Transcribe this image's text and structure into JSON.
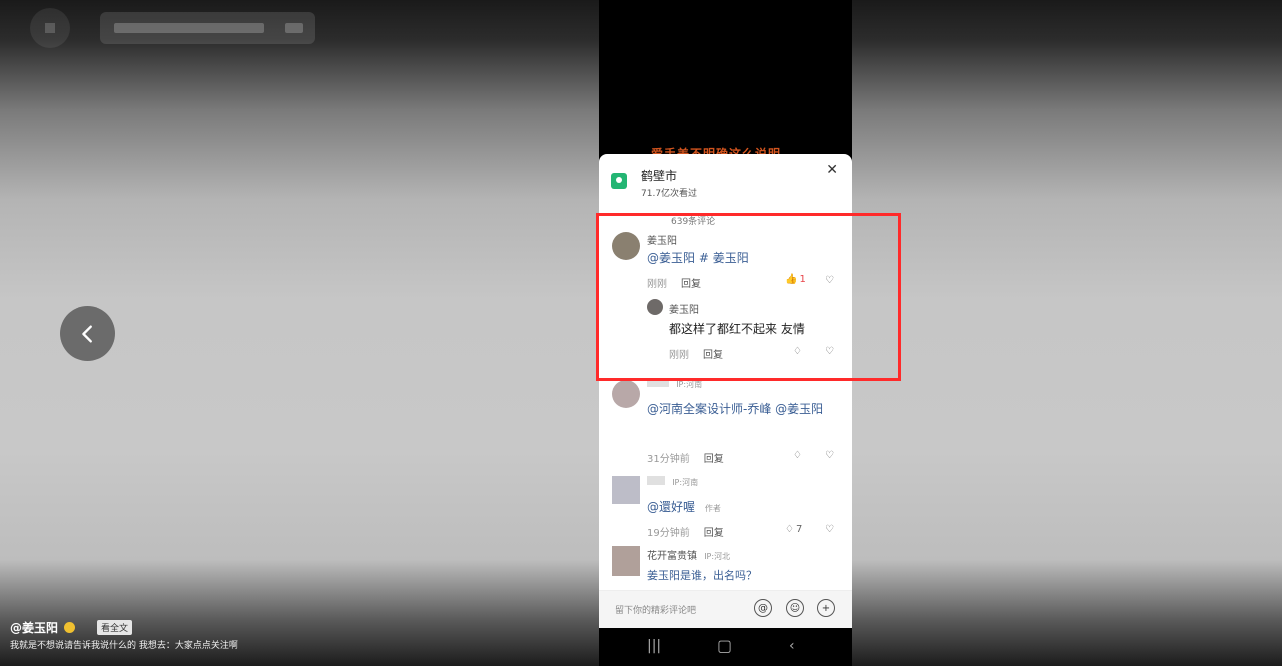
{
  "video_overlay_text": "爱手美不明确这么说明",
  "location": {
    "name": "鹤壁市",
    "views": "71.7亿次看过"
  },
  "comment_count": "639条评论",
  "comments": [
    {
      "author": "姜玉阳",
      "text_mention_1": "@姜玉阳",
      "text_mention_2": "# 姜玉阳",
      "time": "刚刚",
      "reply_label": "回复",
      "likes": "1"
    },
    {
      "author": "姜玉阳",
      "text": "都这样了都红不起来 友情",
      "time": "刚刚",
      "reply_label": "回复"
    },
    {
      "author_ip": "IP:河南",
      "text_mention_1": "@河南全案设计师-乔峰",
      "text_mention_2": "@姜玉阳",
      "time": "31分钟前",
      "reply_label": "回复"
    },
    {
      "author_ip": "IP:河南",
      "text_mention": "@還好喔",
      "author_tag": "作者",
      "time": "19分钟前",
      "reply_label": "回复",
      "likes": "7"
    },
    {
      "author": "花开富贵镇",
      "author_ip": "IP:河北",
      "text": "姜玉阳是谁，出名吗？"
    }
  ],
  "input": {
    "placeholder": "留下你的精彩评论吧"
  },
  "bottom": {
    "author": "@姜玉阳",
    "tag": "看全文",
    "caption": "我就是不想说请告诉我说什么的 我想去：大家点点关注啊"
  }
}
